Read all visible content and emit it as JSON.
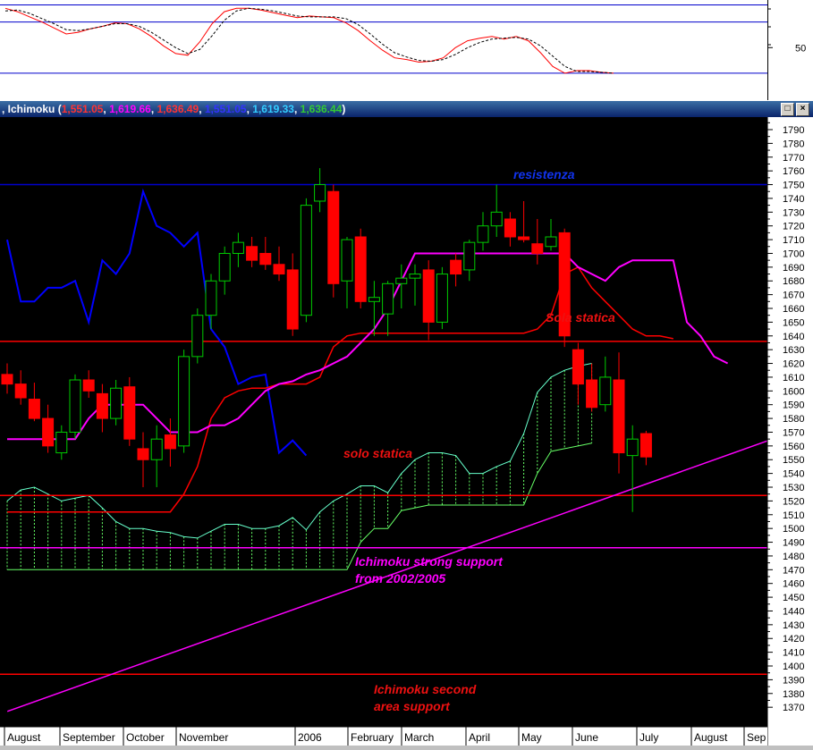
{
  "stochastic_panel": {
    "axis_label": "50"
  },
  "ichimoku_header": {
    "title": "Ichimoku",
    "values": [
      {
        "text": "1,551.05",
        "color": "#ff3333"
      },
      {
        "text": "1,619.66",
        "color": "#ff00ff"
      },
      {
        "text": "1,636.49",
        "color": "#ff3333"
      },
      {
        "text": "1,551.05",
        "color": "#3333ff"
      },
      {
        "text": "1,619.33",
        "color": "#33ccff"
      },
      {
        "text": "1,636.44",
        "color": "#33cc33"
      }
    ]
  },
  "annotations": {
    "resistenza": "resistenza",
    "sola_statica": "Sola statica",
    "solo_statica": "solo statica",
    "strong_support_1": "Ichimoku strong support",
    "strong_support_2": "from 2002/2005",
    "second_support_1": "Ichimoku second",
    "second_support_2": "area support"
  },
  "colors": {
    "background": "#000000",
    "bull_candle": "#00cc00",
    "bear_candle": "#ff0000",
    "tenkan": "#ff00ff",
    "kijun": "#ff0000",
    "chikou": "#0000ff",
    "cloud": "#66ff66",
    "level_red": "#ff0000",
    "level_magenta": "#ff00ff",
    "level_blue": "#0000cc"
  },
  "chart_data": [
    {
      "type": "line",
      "name": "stochastic oscillator",
      "yticks": [
        50
      ],
      "ylim": [
        0,
        100
      ],
      "reference_lines": [
        80,
        20
      ],
      "series": [
        {
          "color": "#ff0000",
          "values": [
            96,
            92,
            86,
            80,
            73,
            66,
            68,
            72,
            75,
            79,
            78,
            72,
            63,
            52,
            43,
            41,
            57,
            78,
            92,
            96,
            96,
            94,
            91,
            88,
            85,
            87,
            86,
            85,
            79,
            70,
            58,
            47,
            38,
            36,
            33,
            34,
            38,
            50,
            58,
            61,
            63,
            60,
            63,
            58,
            44,
            28,
            20,
            23,
            23,
            21,
            20
          ]
        },
        {
          "color": "#000000",
          "values": [
            93,
            94,
            90,
            84,
            78,
            71,
            70,
            72,
            75,
            78,
            78,
            75,
            68,
            59,
            50,
            43,
            48,
            64,
            82,
            93,
            96,
            95,
            93,
            90,
            87,
            86,
            86,
            86,
            84,
            77,
            66,
            54,
            44,
            39,
            35,
            34,
            36,
            42,
            50,
            56,
            60,
            61,
            62,
            60,
            52,
            40,
            28,
            22,
            22,
            21,
            20
          ]
        }
      ]
    },
    {
      "type": "line",
      "name": "Ichimoku weekly",
      "ylim": [
        1360,
        1795
      ],
      "yticks": [
        1370,
        1380,
        1390,
        1400,
        1410,
        1420,
        1430,
        1440,
        1450,
        1460,
        1470,
        1480,
        1490,
        1500,
        1510,
        1520,
        1530,
        1540,
        1550,
        1560,
        1570,
        1580,
        1590,
        1600,
        1610,
        1620,
        1630,
        1640,
        1650,
        1660,
        1670,
        1680,
        1690,
        1700,
        1710,
        1720,
        1730,
        1740,
        1750,
        1760,
        1770,
        1780,
        1790
      ],
      "xticks": [
        "August",
        "September",
        "October",
        "November",
        "2006",
        "February",
        "March",
        "April",
        "May",
        "June",
        "July",
        "August",
        "Sep"
      ],
      "candles": [
        {
          "o": 1612,
          "h": 1620,
          "l": 1598,
          "c": 1605
        },
        {
          "o": 1605,
          "h": 1615,
          "l": 1590,
          "c": 1595
        },
        {
          "o": 1594,
          "h": 1606,
          "l": 1578,
          "c": 1580
        },
        {
          "o": 1580,
          "h": 1590,
          "l": 1555,
          "c": 1560
        },
        {
          "o": 1555,
          "h": 1575,
          "l": 1550,
          "c": 1570
        },
        {
          "o": 1570,
          "h": 1612,
          "l": 1565,
          "c": 1608
        },
        {
          "o": 1608,
          "h": 1615,
          "l": 1595,
          "c": 1600
        },
        {
          "o": 1598,
          "h": 1605,
          "l": 1570,
          "c": 1580
        },
        {
          "o": 1580,
          "h": 1608,
          "l": 1575,
          "c": 1602
        },
        {
          "o": 1603,
          "h": 1610,
          "l": 1560,
          "c": 1565
        },
        {
          "o": 1558,
          "h": 1570,
          "l": 1530,
          "c": 1550
        },
        {
          "o": 1550,
          "h": 1575,
          "l": 1530,
          "c": 1565
        },
        {
          "o": 1568,
          "h": 1580,
          "l": 1545,
          "c": 1558
        },
        {
          "o": 1560,
          "h": 1630,
          "l": 1555,
          "c": 1625
        },
        {
          "o": 1625,
          "h": 1660,
          "l": 1620,
          "c": 1655
        },
        {
          "o": 1655,
          "h": 1685,
          "l": 1645,
          "c": 1680
        },
        {
          "o": 1680,
          "h": 1705,
          "l": 1670,
          "c": 1700
        },
        {
          "o": 1700,
          "h": 1715,
          "l": 1690,
          "c": 1708
        },
        {
          "o": 1705,
          "h": 1712,
          "l": 1690,
          "c": 1695
        },
        {
          "o": 1700,
          "h": 1712,
          "l": 1688,
          "c": 1692
        },
        {
          "o": 1692,
          "h": 1705,
          "l": 1680,
          "c": 1685
        },
        {
          "o": 1688,
          "h": 1700,
          "l": 1640,
          "c": 1645
        },
        {
          "o": 1655,
          "h": 1740,
          "l": 1650,
          "c": 1735
        },
        {
          "o": 1738,
          "h": 1762,
          "l": 1730,
          "c": 1750
        },
        {
          "o": 1745,
          "h": 1750,
          "l": 1668,
          "c": 1678
        },
        {
          "o": 1680,
          "h": 1712,
          "l": 1660,
          "c": 1710
        },
        {
          "o": 1712,
          "h": 1718,
          "l": 1660,
          "c": 1665
        },
        {
          "o": 1665,
          "h": 1680,
          "l": 1640,
          "c": 1668
        },
        {
          "o": 1656,
          "h": 1680,
          "l": 1640,
          "c": 1678
        },
        {
          "o": 1678,
          "h": 1692,
          "l": 1660,
          "c": 1682
        },
        {
          "o": 1682,
          "h": 1692,
          "l": 1662,
          "c": 1685
        },
        {
          "o": 1688,
          "h": 1695,
          "l": 1637,
          "c": 1650
        },
        {
          "o": 1650,
          "h": 1690,
          "l": 1645,
          "c": 1685
        },
        {
          "o": 1695,
          "h": 1700,
          "l": 1676,
          "c": 1685
        },
        {
          "o": 1688,
          "h": 1710,
          "l": 1680,
          "c": 1708
        },
        {
          "o": 1708,
          "h": 1730,
          "l": 1702,
          "c": 1720
        },
        {
          "o": 1720,
          "h": 1750,
          "l": 1712,
          "c": 1730
        },
        {
          "o": 1725,
          "h": 1730,
          "l": 1705,
          "c": 1712
        },
        {
          "o": 1712,
          "h": 1738,
          "l": 1708,
          "c": 1710
        },
        {
          "o": 1707,
          "h": 1725,
          "l": 1692,
          "c": 1700
        },
        {
          "o": 1705,
          "h": 1725,
          "l": 1702,
          "c": 1712
        },
        {
          "o": 1715,
          "h": 1718,
          "l": 1632,
          "c": 1640
        },
        {
          "o": 1630,
          "h": 1635,
          "l": 1590,
          "c": 1605
        },
        {
          "o": 1608,
          "h": 1620,
          "l": 1585,
          "c": 1588
        },
        {
          "o": 1590,
          "h": 1625,
          "l": 1585,
          "c": 1610
        },
        {
          "o": 1608,
          "h": 1628,
          "l": 1540,
          "c": 1555
        },
        {
          "o": 1553,
          "h": 1575,
          "l": 1512,
          "c": 1565
        },
        {
          "o": 1569,
          "h": 1571,
          "l": 1546,
          "c": 1552
        }
      ],
      "tenkan": [
        1565,
        1565,
        1565,
        1565,
        1565,
        1565,
        1580,
        1590,
        1590,
        1590,
        1590,
        1580,
        1570,
        1570,
        1570,
        1575,
        1575,
        1580,
        1590,
        1600,
        1605,
        1607,
        1612,
        1615,
        1620,
        1625,
        1635,
        1645,
        1660,
        1680,
        1700,
        1700,
        1700,
        1700,
        1700,
        1700,
        1700,
        1700,
        1700,
        1700,
        1700,
        1700,
        1690,
        1685,
        1680,
        1690,
        1695,
        1695,
        1695,
        1695,
        1650,
        1640,
        1625,
        1620
      ],
      "kijun": [
        1512,
        1512,
        1512,
        1512,
        1512,
        1512,
        1512,
        1512,
        1512,
        1512,
        1512,
        1512,
        1512,
        1525,
        1545,
        1580,
        1595,
        1600,
        1602,
        1602,
        1605,
        1605,
        1605,
        1610,
        1632,
        1640,
        1642,
        1642,
        1642,
        1642,
        1642,
        1642,
        1642,
        1642,
        1642,
        1642,
        1642,
        1642,
        1642,
        1645,
        1655,
        1685,
        1690,
        1675,
        1665,
        1655,
        1645,
        1640,
        1640,
        1638
      ],
      "chikou": [
        1710,
        1665,
        1665,
        1675,
        1675,
        1680,
        1650,
        1695,
        1685,
        1700,
        1745,
        1720,
        1715,
        1705,
        1715,
        1645,
        1632,
        1605,
        1610,
        1612,
        1555,
        1564,
        1553
      ],
      "senkou_a": [
        1520,
        1528,
        1530,
        1525,
        1520,
        1522,
        1524,
        1515,
        1505,
        1500,
        1500,
        1498,
        1497,
        1494,
        1493,
        1498,
        1503,
        1503,
        1500,
        1500,
        1502,
        1508,
        1499,
        1512,
        1520,
        1525,
        1531,
        1531,
        1526,
        1540,
        1550,
        1555,
        1555,
        1553,
        1540,
        1540,
        1545,
        1549,
        1569,
        1599,
        1610,
        1615,
        1618,
        1620
      ],
      "senkou_b": [
        1470,
        1470,
        1470,
        1470,
        1470,
        1470,
        1470,
        1470,
        1470,
        1470,
        1470,
        1470,
        1470,
        1470,
        1470,
        1470,
        1470,
        1470,
        1470,
        1470,
        1470,
        1470,
        1470,
        1470,
        1470,
        1470,
        1490,
        1500,
        1500,
        1513,
        1515,
        1517,
        1517,
        1517,
        1517,
        1517,
        1517,
        1517,
        1517,
        1540,
        1556,
        1558,
        1560,
        1562
      ],
      "levels": [
        {
          "y": 1750,
          "color": "#0000cc"
        },
        {
          "y": 1636,
          "color": "#ff0000"
        },
        {
          "y": 1524,
          "color": "#ff0000"
        },
        {
          "y": 1486,
          "color": "#ff00ff"
        },
        {
          "y": 1394,
          "color": "#ff0000"
        }
      ],
      "trendline": {
        "from": [
          1,
          1367
        ],
        "to": [
          57,
          1564
        ],
        "color": "#ff00ff"
      }
    }
  ]
}
